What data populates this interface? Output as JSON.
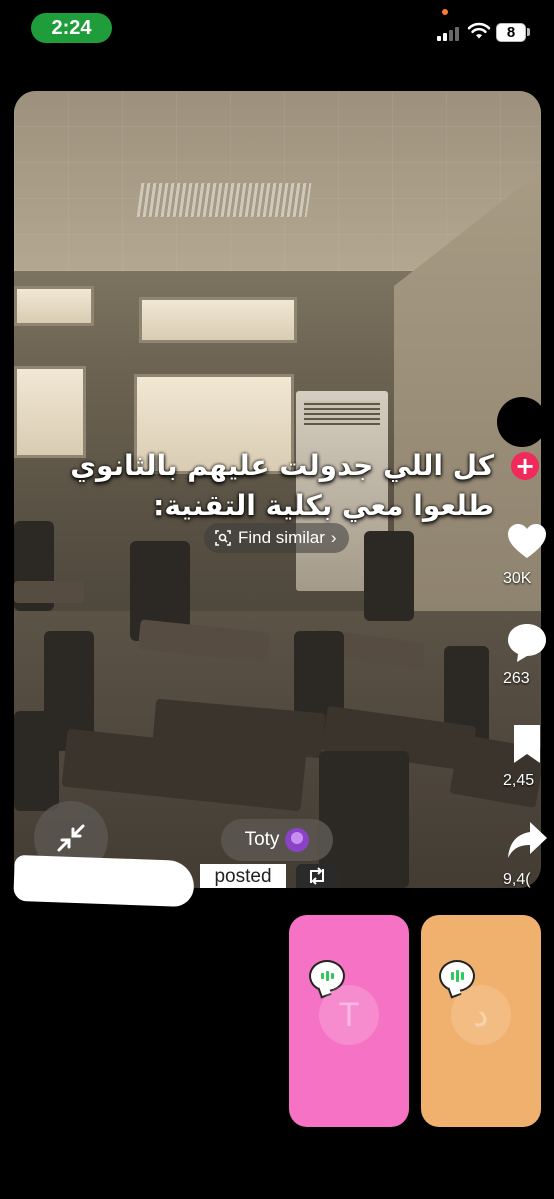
{
  "status_bar": {
    "time": "2:24",
    "battery": "8",
    "signal_icon": "cellular-signal-icon",
    "wifi_icon": "wifi-icon"
  },
  "video": {
    "caption_line1": "كل اللي جدولت عليهم بالثانوي",
    "caption_line2": "طلعوا معي بكلية التقنية:",
    "find_similar_label": "Find similar",
    "find_similar_icon": "image-search-icon",
    "author_tag": "Toty",
    "posted_label": "posted",
    "colors": {
      "follow_accent": "#f02a5a"
    }
  },
  "rail": {
    "likes": "30K",
    "comments": "263",
    "saves": "2,45",
    "shares": "9,4("
  },
  "participants": [
    {
      "initial": "T",
      "color": "#f572c4",
      "speaking_icon": "speaking-bubble-icon"
    },
    {
      "initial": "د",
      "color": "#f0b16e",
      "speaking_icon": "speaking-bubble-icon"
    }
  ]
}
